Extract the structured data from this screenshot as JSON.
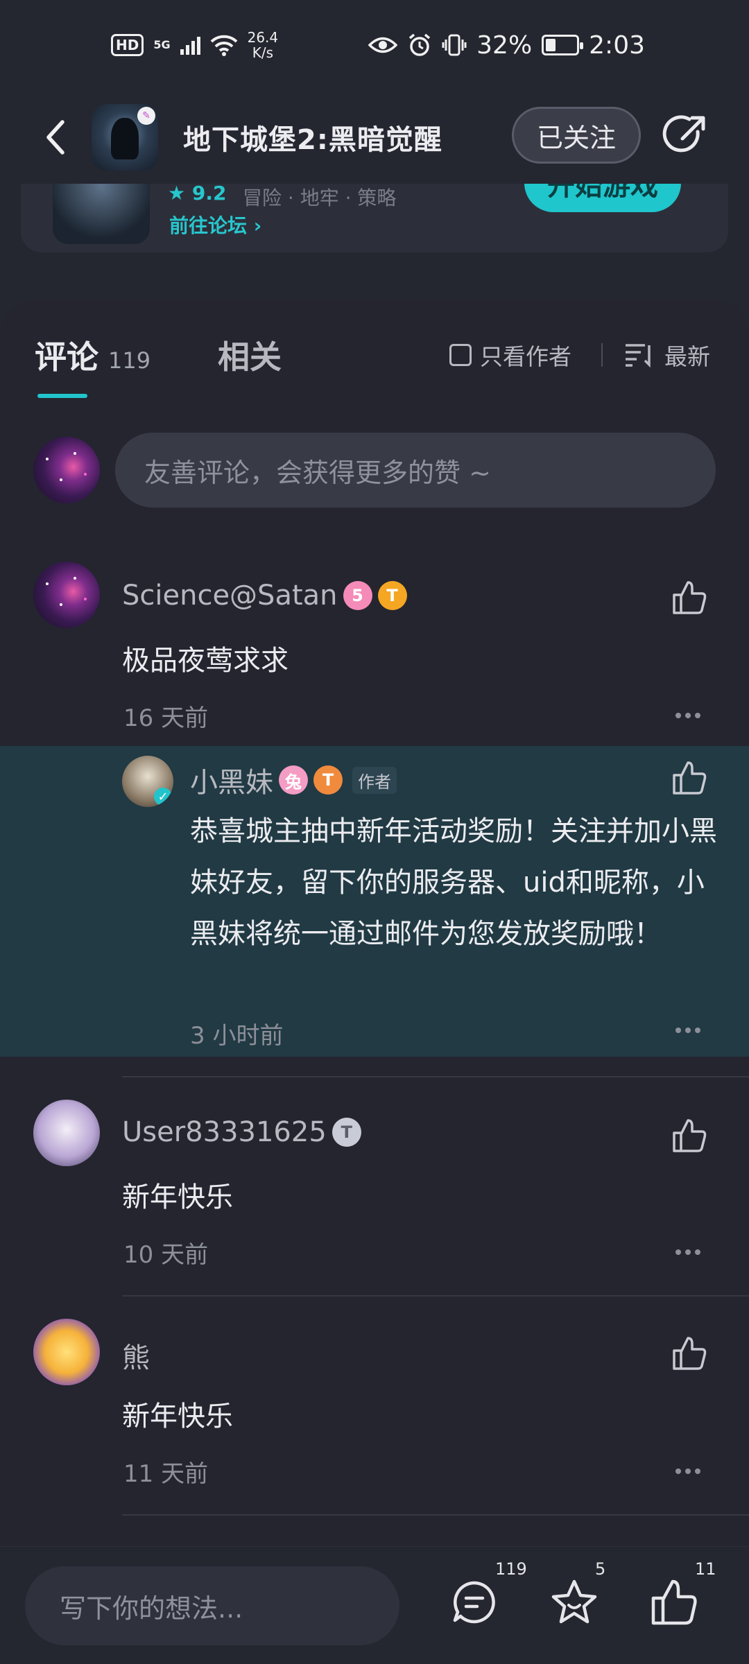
{
  "status_bar": {
    "hd": "HD",
    "network": "5G",
    "speed_value": "26.4",
    "speed_unit": "K/s",
    "battery": "32%",
    "time": "2:03"
  },
  "header": {
    "title": "地下城堡2:黑暗觉醒",
    "follow_label": "已关注"
  },
  "game_card": {
    "rating": "9.2",
    "tags": "冒险 · 地牢 · 策略",
    "forum_link": "前往论坛",
    "play_label": "开始游戏"
  },
  "tabs": {
    "comments_label": "评论",
    "comments_count": "119",
    "related_label": "相关",
    "author_only_label": "只看作者",
    "sort_label": "最新"
  },
  "comment_input": {
    "placeholder": "友善评论，会获得更多的赞 ~"
  },
  "comments": [
    {
      "user": "Science@Satan",
      "text": "极品夜莺求求",
      "time": "16 天前"
    },
    {
      "user": "User83331625",
      "text": "新年快乐",
      "time": "10 天前"
    },
    {
      "user": "熊",
      "text": "新年快乐",
      "time": "11 天前"
    }
  ],
  "reply": {
    "user": "小黑妹",
    "author_tag": "作者",
    "text": "恭喜城主抽中新年活动奖励！关注并加小黑妹好友，留下你的服务器、uid和昵称，小黑妹将统一通过邮件为您发放奖励哦！",
    "time": "3 小时前"
  },
  "bottom_bar": {
    "write_placeholder": "写下你的想法...",
    "comment_count": "119",
    "star_count": "5",
    "like_count": "11"
  },
  "colors": {
    "accent": "#22c4cc",
    "background": "#24252f",
    "reply_highlight": "#213a44"
  }
}
